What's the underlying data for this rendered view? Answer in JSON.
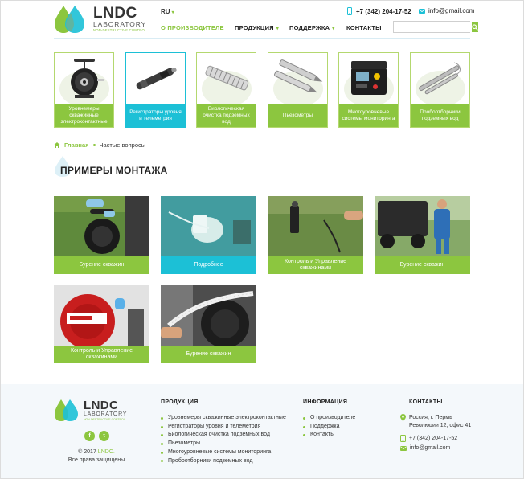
{
  "brand": {
    "logo_title": "LNDC",
    "logo_sub1": "LABORATORY",
    "logo_sub2": "NON-DESTRUCTIVE CONTROL"
  },
  "header": {
    "lang": "RU",
    "phone": "+7 (342) 204-17-52",
    "email": "info@gmail.com",
    "search_placeholder": ""
  },
  "nav": [
    {
      "label": "О ПРОИЗВОДИТЕЛЕ",
      "active": true
    },
    {
      "label": "ПРОДУКЦИЯ",
      "dropdown": true
    },
    {
      "label": "ПОДДЕРЖКА",
      "dropdown": true
    },
    {
      "label": "КОНТАКТЫ"
    }
  ],
  "categories": [
    {
      "label": "Уровнемеры скважинные электроконтактные",
      "icon": "tape-reel-icon"
    },
    {
      "label": "Регистраторы уровня и телеметрия",
      "icon": "logger-probe-icon",
      "active": true
    },
    {
      "label": "Биологическая очистка подземных вод",
      "icon": "filter-cylinder-icon"
    },
    {
      "label": "Пьезометры",
      "icon": "piezometer-icon"
    },
    {
      "label": "Многоуровневые системы мониторинга",
      "icon": "case-icon"
    },
    {
      "label": "Пробоотборники подземных вод",
      "icon": "sampler-icon"
    }
  ],
  "breadcrumb": {
    "home": "Главная",
    "current": "Частые вопросы"
  },
  "page_title": "ПРИМЕРЫ МОНТАЖА",
  "tiles": [
    {
      "caption": "Бурение скважин"
    },
    {
      "caption": "Подробнее",
      "active": true
    },
    {
      "caption": "Контроль и Управление скважинами"
    },
    {
      "caption": "Бурение скважин"
    },
    {
      "caption": "Контроль и Управление скважинами"
    },
    {
      "caption": "Бурение скважин"
    }
  ],
  "footer": {
    "copyright_prefix": "© 2017 ",
    "copyright_brand": "LNDC.",
    "rights": "Все права защищены",
    "social": [
      "f",
      "t"
    ],
    "products_title": "ПРОДУКЦИЯ",
    "products": [
      "Уровнемеры скважинные электроконтактные",
      "Регистраторы уровня и телеметрия",
      "Биологическая очистка подземных вод",
      "Пьезометры",
      "Многоуровневые системы мониторинга",
      "Пробоотборники подземных вод"
    ],
    "info_title": "ИНФОРМАЦИЯ",
    "info": [
      "О производителе",
      "Поддержка",
      "Контакты"
    ],
    "contacts_title": "КОНТАКТЫ",
    "address1": "Россия, г. Пермь",
    "address2": "Революции 12, офис 41",
    "phone": "+7 (342) 204-17-52",
    "email": "info@gmail.com"
  },
  "colors": {
    "green": "#8cc63f",
    "cyan": "#1cc0d6",
    "footer_bg": "#f4f8fb"
  }
}
